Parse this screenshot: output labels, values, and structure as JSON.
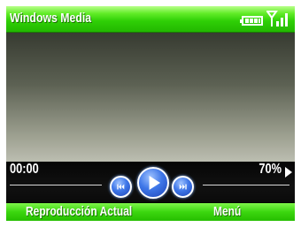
{
  "app": {
    "title": "Windows Media"
  },
  "status_icons": {
    "battery": "battery-icon",
    "signal": "signal-strength-icon"
  },
  "player": {
    "elapsed": "00:00",
    "volume_label": "70%",
    "volume_level": 0.7,
    "progress": 0,
    "buttons": {
      "previous": "previous-track-icon",
      "play": "play-icon",
      "next": "next-track-icon"
    }
  },
  "softkeys": {
    "left": "Reproducción Actual",
    "right": "Menú"
  },
  "colors": {
    "accent": "#2fcf06",
    "button": "#3f77e8"
  }
}
